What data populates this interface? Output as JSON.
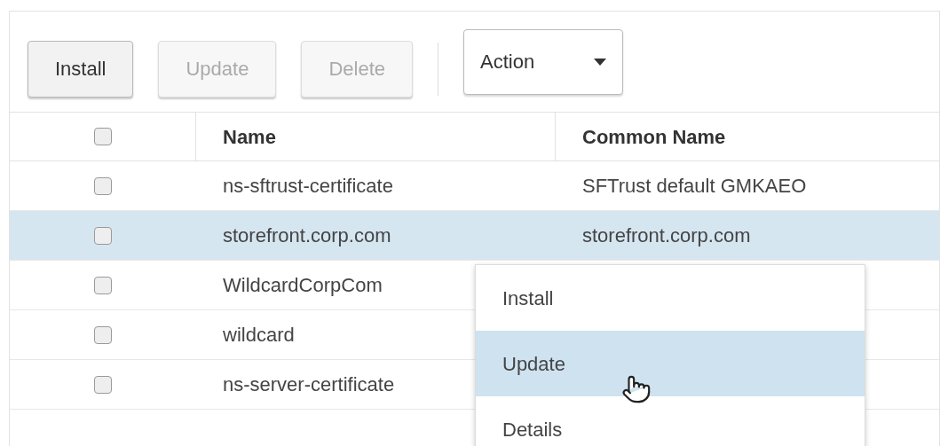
{
  "toolbar": {
    "buttons": [
      {
        "label": "Install",
        "disabled": false
      },
      {
        "label": "Update",
        "disabled": true
      },
      {
        "label": "Delete",
        "disabled": true
      }
    ],
    "action_dropdown": {
      "label": "Action"
    }
  },
  "table": {
    "header_checked": false,
    "columns": [
      "Name",
      "Common Name"
    ],
    "rows": [
      {
        "checked": false,
        "selected": false,
        "cells": [
          "ns-sftrust-certificate",
          "SFTrust default GMKAEO"
        ]
      },
      {
        "checked": false,
        "selected": true,
        "cells": [
          "storefront.corp.com",
          "storefront.corp.com"
        ]
      },
      {
        "checked": false,
        "selected": false,
        "cells": [
          "WildcardCorpCom"
        ]
      },
      {
        "checked": false,
        "selected": false,
        "cells": [
          "wildcard"
        ]
      },
      {
        "checked": false,
        "selected": false,
        "cells": [
          "ns-server-certificate"
        ]
      }
    ]
  },
  "context_menu": {
    "items": [
      {
        "label": "Install",
        "selected": false
      },
      {
        "label": "Update",
        "selected": true
      },
      {
        "label": "Details",
        "selected": false
      }
    ]
  }
}
